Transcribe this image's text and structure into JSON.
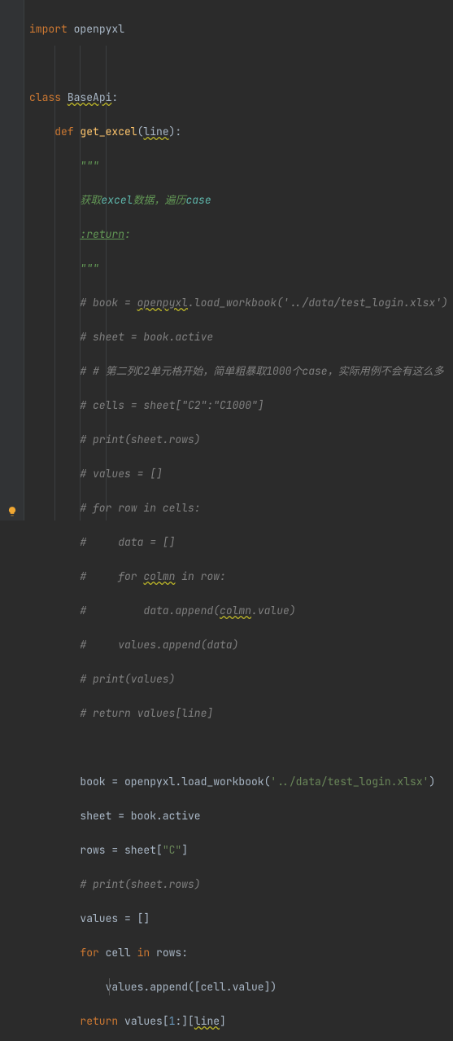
{
  "imports": {
    "line1_kw": "import",
    "line1_mod": " openpyxl"
  },
  "classdef": {
    "kw": "class ",
    "name": "BaseApi",
    "tail": ":"
  },
  "funcdef": {
    "kw": "def ",
    "name": "get_excel",
    "open": "(",
    "param": "line",
    "close": "):"
  },
  "doc": {
    "q1": "\"\"\"",
    "l1a": "获取",
    "l1b": "excel",
    "l1c": "数据，遍历",
    "l1d": "case",
    "ret": ":return",
    "ret_tail": ":",
    "q2": "\"\"\""
  },
  "c": {
    "b1a": "# book = ",
    "b1b": "openpyxl",
    "b1c": ".load_workbook('../data/test_login.xlsx')",
    "b2": "# sheet = book.active",
    "b3": "# # 第二列C2单元格开始，简单粗暴取1000个case，实际用例不会有这么多",
    "b4": "# cells = sheet[\"C2\":\"C1000\"]",
    "b5": "# print(sheet.rows)",
    "b6": "# values = []",
    "b7": "# for row in cells:",
    "b8": "#     data = []",
    "b9a": "#     for ",
    "b9b": "colmn",
    "b9c": " in row:",
    "b10a": "#         data.append(",
    "b10b": "colmn",
    "b10c": ".value)",
    "b11": "#     values.append(data)",
    "b12": "# print(values)",
    "b13": "# return values[line]"
  },
  "live": {
    "l1a": "book = openpyxl.load_workbook(",
    "l1b": "'../data/test_login.xlsx'",
    "l1c": ")",
    "l2": "sheet = book.active",
    "l3a": "rows = sheet[",
    "l3b": "\"C\"",
    "l3c": "]",
    "l4": "# print(sheet.rows)",
    "l5": "values = []",
    "l6a": "for ",
    "l6b": "cell ",
    "l6c": "in ",
    "l6d": "rows:",
    "l7": "values.append([cell.value])",
    "l8a": "return ",
    "l8b": "values[",
    "l8c": "1",
    "l8d": ":][",
    "l8e": "line",
    "l8f": "]"
  }
}
